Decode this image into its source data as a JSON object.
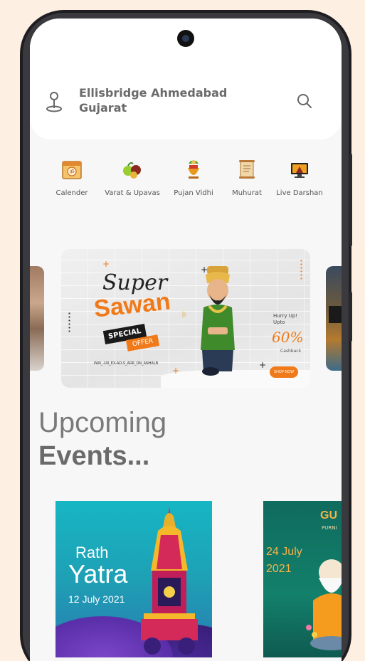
{
  "header": {
    "location_line1": "Ellisbridge Ahmedabad",
    "location_line2": "Gujarat",
    "location_icon": "map-pin-icon",
    "search_icon": "search-icon"
  },
  "categories": [
    {
      "label": "Calender",
      "icon": "calendar-icon"
    },
    {
      "label": "Varat & Upavas",
      "icon": "offering-icon"
    },
    {
      "label": "Pujan Vidhi",
      "icon": "kalash-icon"
    },
    {
      "label": "Muhurat",
      "icon": "scroll-icon"
    },
    {
      "label": "Live Darshan",
      "icon": "monitor-icon"
    }
  ],
  "banner": {
    "title_1": "Super",
    "title_2": "Sawan",
    "special": "SPECIAL",
    "offer": "OFFER",
    "hurry": "Hurry Up!",
    "upto": "Upto",
    "percent": "60%",
    "cashback": "Cashback",
    "promo": "PAN_-UR_EX-AD-S_ARR_ON_ANHALB",
    "cta": "SHOP NOW"
  },
  "events_heading": {
    "line1": "Upcoming",
    "line2": "Events..."
  },
  "events": [
    {
      "title_top": "Rath",
      "title_main": "Yatra",
      "date": "12 July 2021",
      "bg": "#16b6c4"
    },
    {
      "title": "GU",
      "subtitle": "PURNI",
      "date_line1": "24 July",
      "date_line2": "2021",
      "bg": "#0f6b5e"
    }
  ],
  "colors": {
    "accent": "#f07a1a",
    "background": "#fdf0e2",
    "screen": "#f7f7f7"
  }
}
